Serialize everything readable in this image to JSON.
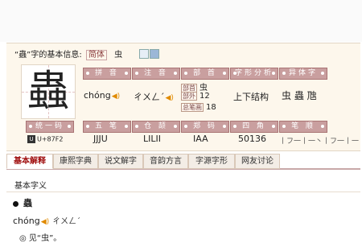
{
  "header": {
    "char_quoted": "“蟲”字的基本信息:",
    "simplified_tag": "简体",
    "simplified_char": "虫"
  },
  "character": "蟲",
  "fields": {
    "pinyin": {
      "label": "拼 音",
      "value": "chóng"
    },
    "zhuyin": {
      "label": "注 音",
      "value": "ㄔㄨㄥˊ"
    },
    "bushou": {
      "label": "部 首",
      "radical_tag": "部首",
      "radical": "虫",
      "strokes_tag": "部外",
      "strokes": "12",
      "total_tag": "总笔画",
      "total": "18"
    },
    "zixing": {
      "label": "字形分析",
      "value": "上下结构"
    },
    "yiti": {
      "label": "异体字",
      "value": "虫 蟲 虺"
    },
    "tongyima": {
      "label": "统一码",
      "value": "U+87F2"
    },
    "wubi": {
      "label": "五 笔",
      "value": "JJJU"
    },
    "cangjie": {
      "label": "仓 颉",
      "value": "LILII"
    },
    "zhengma": {
      "label": "郑 码",
      "value": "IAA"
    },
    "sijiao": {
      "label": "四 角",
      "value": "50136"
    },
    "bishun": {
      "label": "笔 顺",
      "value": "丨フ一丨一丶丨フ一丨一丶丨フ一丨一丶"
    }
  },
  "tabs": [
    "基本解释",
    "康熙字典",
    "说文解字",
    "音韵方言",
    "字源字形",
    "网友讨论"
  ],
  "section_title": "基本字义",
  "entry": {
    "char": "蟲",
    "pinyin": "chóng",
    "zhuyin": "ㄔㄨㄥˊ",
    "definition": "◎ 见“虫”。"
  }
}
